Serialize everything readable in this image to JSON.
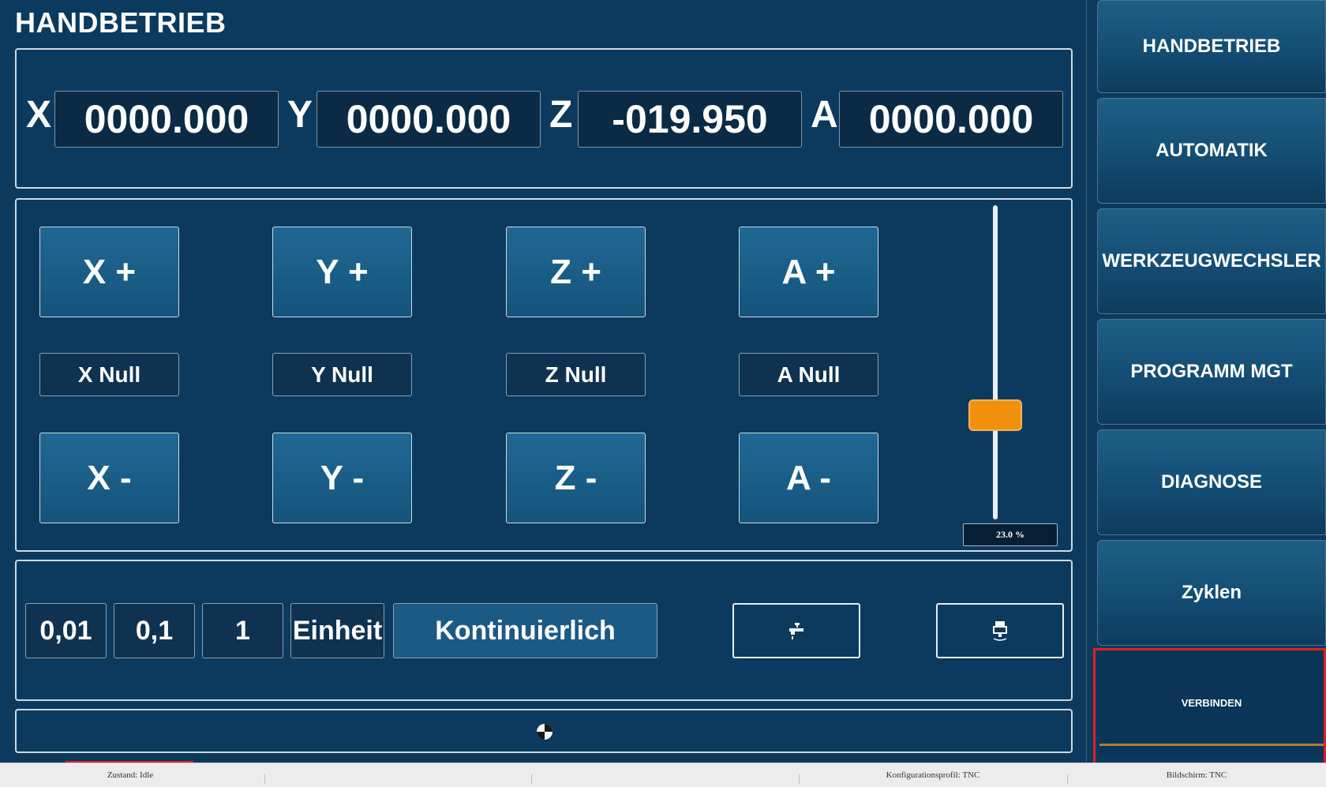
{
  "header": {
    "title": "HANDBETRIEB"
  },
  "position": {
    "axes": [
      {
        "label": "X",
        "value": "0000.000"
      },
      {
        "label": "Y",
        "value": "0000.000"
      },
      {
        "label": "Z",
        "value": "-019.950"
      },
      {
        "label": "A",
        "value": "0000.000"
      }
    ]
  },
  "jog": {
    "plus": [
      "X +",
      "Y +",
      "Z +",
      "A +"
    ],
    "null": [
      "X Null",
      "Y Null",
      "Z Null",
      "A Null"
    ],
    "minus": [
      "X -",
      "Y -",
      "Z -",
      "A -"
    ]
  },
  "feed_override": {
    "value_percent": 23.0,
    "label": "23.0 %"
  },
  "step": {
    "options": [
      "0,01",
      "0,1",
      "1",
      "Einheit",
      "Kontinuierlich"
    ]
  },
  "icons": {
    "coolant": "faucet-icon",
    "tool": "spindle-icon",
    "busy": "busy-spinner-icon"
  },
  "sidebar": {
    "items": [
      {
        "label": "HANDBETRIEB"
      },
      {
        "label": "AUTOMATIK"
      },
      {
        "label": "WERKZEUGWECHSLER"
      },
      {
        "label": "PROGRAMM MGT"
      },
      {
        "label": "DIAGNOSE"
      },
      {
        "label": "Zyklen"
      },
      {
        "label": "VERBINDEN"
      }
    ]
  },
  "statusbar": {
    "state": "Zustand: Idle",
    "profile": "Konfigurationsprofil: TNC",
    "screen": "Bildschirm: TNC"
  },
  "colors": {
    "background": "#0c3a5e",
    "button": "#1f6893",
    "slider_thumb": "#f0900d",
    "highlight": "#e02020"
  }
}
